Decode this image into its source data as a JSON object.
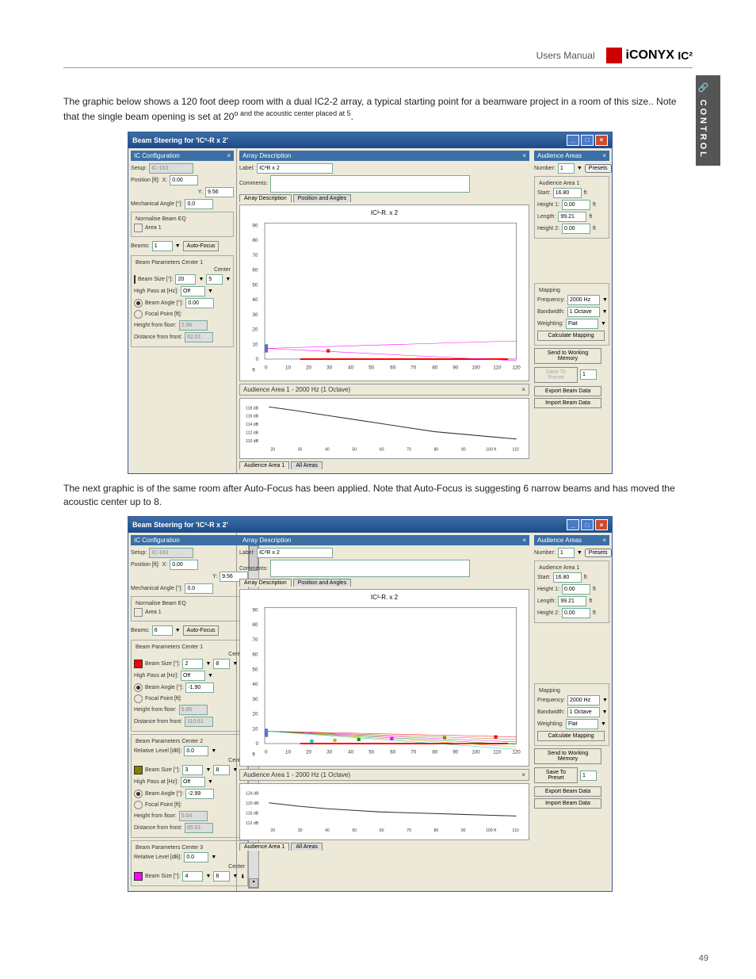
{
  "header": {
    "users_manual": "Users Manual",
    "logo_text": "iCONYX",
    "logo_ic2": "IC²"
  },
  "side_tab": "CONTROL",
  "paragraphs": {
    "p1a": "The graphic below shows a 120 foot deep room with a dual IC2-2 array, a typical starting point for a beamware project in a room of this size.. Note that the single beam opening is set at 20",
    "p1sup": "o and the acoustic center placed at 5",
    "p1b": ".",
    "p2": "The next graphic is of the same room after Auto-Focus has been applied. Note that Auto-Focus is suggesting 6 narrow beams and has moved the acoustic center up to 8."
  },
  "page_number": "49",
  "win1": {
    "title": "Beam Steering for 'IC²-R x 2'",
    "left": {
      "title": "IC Configuration",
      "setup_lbl": "Setup:",
      "setup_val": "IC-163",
      "pos_lbl": "Position [ft]:",
      "pos_x_lbl": "X:",
      "pos_x": "0.00",
      "pos_y_lbl": "Y:",
      "pos_y": "9.56",
      "mech_lbl": "Mechanical Angle [°]:",
      "mech": "0.0",
      "norm_eq": "Normalise Beam EQ",
      "area1": "Area 1",
      "beams_lbl": "Beams:",
      "beams_val": "1",
      "autofocus": "Auto-Focus",
      "bpc1": "Beam Parameters Center 1",
      "center": "Center",
      "beamsize_lbl": "Beam Size [°]:",
      "beamsize": "20",
      "beamsize_center": "5",
      "hp_lbl": "High Pass at [Hz]:",
      "hp": "Off",
      "bangle_lbl": "Beam Angle [°]:",
      "bangle": "0.00",
      "focal_lbl": "Focal Point [ft]:",
      "hff_lbl": "Height from floor:",
      "hff": "2.96",
      "dff_lbl": "Distance from front:",
      "dff": "62.01"
    },
    "mid": {
      "title": "Array Description",
      "label_lbl": "Label:",
      "label_val": "IC²R x 2",
      "comments_lbl": "Comments:",
      "tab1": "Array Description",
      "tab2": "Position and Angles",
      "chart_title": "IC²-R. x 2",
      "aud_label": "Audience Area 1 - 2000 Hz (1 Octave)",
      "bottom_tab1": "Audience Area 1",
      "bottom_tab2": "All Areas"
    },
    "right": {
      "title": "Audience Areas",
      "number_lbl": "Number:",
      "number": "1",
      "presets": "Presets",
      "aa1": "Audience Area 1",
      "start_lbl": "Start:",
      "start": "16.80",
      "h1_lbl": "Height 1:",
      "h1": "0.00",
      "len_lbl": "Length:",
      "len": "99.21",
      "h2_lbl": "Height 2:",
      "h2": "0.00",
      "unit": "ft",
      "mapping": "Mapping",
      "freq_lbl": "Frequency:",
      "freq": "2000 Hz",
      "bw_lbl": "Bandwidth:",
      "bw": "1 Octave",
      "wt_lbl": "Weighting:",
      "wt": "Flat",
      "calc": "Calculate Mapping",
      "send": "Send to Working Memory",
      "save": "Save To Preset",
      "preset_num": "1",
      "export": "Export Beam Data",
      "import": "Import Beam Data"
    }
  },
  "win2": {
    "title": "Beam Steering for 'IC²-R x 2'",
    "left": {
      "title": "IC Configuration",
      "setup_lbl": "Setup:",
      "setup_val": "IC-163",
      "pos_lbl": "Position [ft]:",
      "pos_x_lbl": "X:",
      "pos_x": "0.00",
      "pos_y_lbl": "Y:",
      "pos_y": "9.56",
      "mech_lbl": "Mechanical Angle [°]:",
      "mech": "0.0",
      "norm_eq": "Normalise Beam EQ",
      "area1": "Area 1",
      "beams_lbl": "Beams:",
      "beams_val": "6",
      "autofocus": "Auto-Focus",
      "bpc1": "Beam Parameters Center 1",
      "center": "Center",
      "beamsize_lbl": "Beam Size [°]:",
      "beamsize": "2",
      "beamsize_center": "8",
      "hp_lbl": "High Pass at [Hz]:",
      "hp": "Off",
      "bangle_lbl": "Beam Angle [°]:",
      "bangle": "-1.90",
      "focal_lbl": "Focal Point [ft]:",
      "hff_lbl": "Height from floor:",
      "hff": "5.85",
      "dff_lbl": "Distance from front:",
      "dff": "110.61",
      "bpc2": "Beam Parameters Center 2",
      "rel_lbl": "Relative Level [dB]:",
      "rel": "0.0",
      "bs2_lbl": "Beam Size [°]:",
      "bs2": "3",
      "bs2_center": "8",
      "hp2_lbl": "High Pass at [Hz]:",
      "hp2": "Off",
      "ba2_lbl": "Beam Angle [°]:",
      "ba2": "-2.99",
      "fp2_lbl": "Focal Point [ft]:",
      "hff2_lbl": "Height from floor:",
      "hff2": "5.04",
      "dff2_lbl": "Distance from front:",
      "dff2": "85.91",
      "bpc3": "Beam Parameters Center 3",
      "rel3_lbl": "Relative Level [dB]:",
      "rel3": "0.0",
      "bs3_lbl": "Beam Size [°]:",
      "bs3": "4",
      "bs3_center": "8"
    },
    "mid": {
      "title": "Array Description",
      "label_lbl": "Label:",
      "label_val": "IC²R x 2",
      "comments_lbl": "Comments:",
      "tab1": "Array Description",
      "tab2": "Position and Angles",
      "chart_title": "IC²-R. x 2",
      "aud_label": "Audience Area 1 - 2000 Hz (1 Octave)",
      "bottom_tab1": "Audience Area 1",
      "bottom_tab2": "All Areas"
    },
    "right": {
      "title": "Audience Areas",
      "number_lbl": "Number:",
      "number": "1",
      "presets": "Presets",
      "aa1": "Audience Area 1",
      "start_lbl": "Start:",
      "start": "16.80",
      "h1_lbl": "Height 1:",
      "h1": "0.00",
      "len_lbl": "Length:",
      "len": "99.21",
      "h2_lbl": "Height 2:",
      "h2": "0.00",
      "unit": "ft",
      "mapping": "Mapping",
      "freq_lbl": "Frequency:",
      "freq": "2000 Hz",
      "bw_lbl": "Bandwidth:",
      "bw": "1 Octave",
      "wt_lbl": "Weighting:",
      "wt": "Flat",
      "calc": "Calculate Mapping",
      "send": "Send to Working Memory",
      "save": "Save To Preset",
      "preset_num": "1",
      "export": "Export Beam Data",
      "import": "Import Beam Data"
    }
  },
  "chart_data": [
    {
      "type": "line",
      "title": "IC²-R. x 2",
      "xlabel": "ft",
      "xlim": [
        0,
        120
      ],
      "ylim": [
        0,
        90
      ],
      "x_ticks": [
        0,
        10,
        20,
        30,
        40,
        50,
        60,
        70,
        80,
        90,
        100,
        110,
        120
      ],
      "y_ticks": [
        0,
        10,
        20,
        30,
        40,
        50,
        60,
        70,
        80,
        90
      ],
      "series": [
        {
          "name": "audience-area",
          "x": [
            17,
            116
          ],
          "y": [
            0,
            0
          ],
          "color": "red"
        },
        {
          "name": "array",
          "x": [
            0,
            0
          ],
          "y": [
            6,
            10
          ],
          "color": "blue"
        },
        {
          "name": "beam-upper",
          "x": [
            0,
            120
          ],
          "y": [
            8,
            12
          ],
          "color": "magenta"
        },
        {
          "name": "beam-lower",
          "x": [
            0,
            120
          ],
          "y": [
            8,
            -2
          ],
          "color": "magenta"
        }
      ]
    },
    {
      "type": "line",
      "title": "Audience Area 1 - 2000 Hz (1 Octave)",
      "xlabel": "ft",
      "xlim": [
        20,
        110
      ],
      "ylim": [
        110,
        118
      ],
      "x_ticks": [
        20,
        30,
        40,
        50,
        60,
        70,
        80,
        90,
        100,
        110
      ],
      "y_ticks": [
        "110 dB",
        "112 dB",
        "114 dB",
        "116 dB",
        "118 dB"
      ],
      "series": [
        {
          "name": "spl",
          "x": [
            20,
            30,
            40,
            50,
            60,
            70,
            80,
            90,
            100,
            110
          ],
          "y": [
            118,
            117,
            116,
            115,
            114,
            113,
            112,
            111.5,
            111,
            110.5
          ]
        }
      ]
    },
    {
      "type": "line",
      "title": "IC²-R. x 2",
      "xlabel": "ft",
      "xlim": [
        0,
        120
      ],
      "ylim": [
        0,
        90
      ],
      "x_ticks": [
        0,
        10,
        20,
        30,
        40,
        50,
        60,
        70,
        80,
        90,
        100,
        110,
        120
      ],
      "y_ticks": [
        0,
        10,
        20,
        30,
        40,
        50,
        60,
        70,
        80,
        90
      ],
      "series": [
        {
          "name": "audience-area",
          "x": [
            17,
            116
          ],
          "y": [
            0,
            0
          ],
          "color": "red"
        },
        {
          "name": "array",
          "x": [
            0,
            0
          ],
          "y": [
            6,
            10
          ],
          "color": "blue"
        },
        {
          "name": "beam1",
          "x": [
            0,
            120
          ],
          "y": [
            8,
            4
          ],
          "color": "red"
        },
        {
          "name": "beam2",
          "x": [
            0,
            120
          ],
          "y": [
            8,
            2
          ],
          "color": "olive"
        },
        {
          "name": "beam3",
          "x": [
            0,
            120
          ],
          "y": [
            8,
            0
          ],
          "color": "magenta"
        },
        {
          "name": "beam4",
          "x": [
            0,
            120
          ],
          "y": [
            8,
            -1
          ],
          "color": "green"
        },
        {
          "name": "beam5",
          "x": [
            0,
            120
          ],
          "y": [
            8,
            -2
          ],
          "color": "orange"
        },
        {
          "name": "beam6",
          "x": [
            0,
            120
          ],
          "y": [
            8,
            -3
          ],
          "color": "cyan"
        },
        {
          "name": "center-1",
          "x": [
            110
          ],
          "y": [
            4
          ],
          "color": "red",
          "marker": true
        },
        {
          "name": "center-2",
          "x": [
            86
          ],
          "y": [
            4
          ],
          "color": "olive",
          "marker": true
        },
        {
          "name": "center-3",
          "x": [
            60
          ],
          "y": [
            4
          ],
          "color": "magenta",
          "marker": true
        },
        {
          "name": "center-4",
          "x": [
            45
          ],
          "y": [
            4
          ],
          "color": "green",
          "marker": true
        },
        {
          "name": "center-5",
          "x": [
            33
          ],
          "y": [
            4
          ],
          "color": "orange",
          "marker": true
        },
        {
          "name": "center-6",
          "x": [
            22
          ],
          "y": [
            4
          ],
          "color": "cyan",
          "marker": true
        }
      ]
    },
    {
      "type": "line",
      "title": "Audience Area 1 - 2000 Hz (1 Octave)",
      "xlabel": "ft",
      "xlim": [
        20,
        110
      ],
      "ylim": [
        112,
        124
      ],
      "x_ticks": [
        20,
        30,
        40,
        50,
        60,
        70,
        80,
        90,
        100,
        110
      ],
      "y_ticks": [
        "112 dB",
        "116 dB",
        "120 dB",
        "124 dB"
      ],
      "series": [
        {
          "name": "spl",
          "x": [
            20,
            30,
            40,
            50,
            60,
            70,
            80,
            90,
            100,
            110
          ],
          "y": [
            120,
            118,
            117,
            116.5,
            116,
            115.5,
            115,
            114.5,
            114,
            113.5
          ]
        }
      ]
    }
  ]
}
